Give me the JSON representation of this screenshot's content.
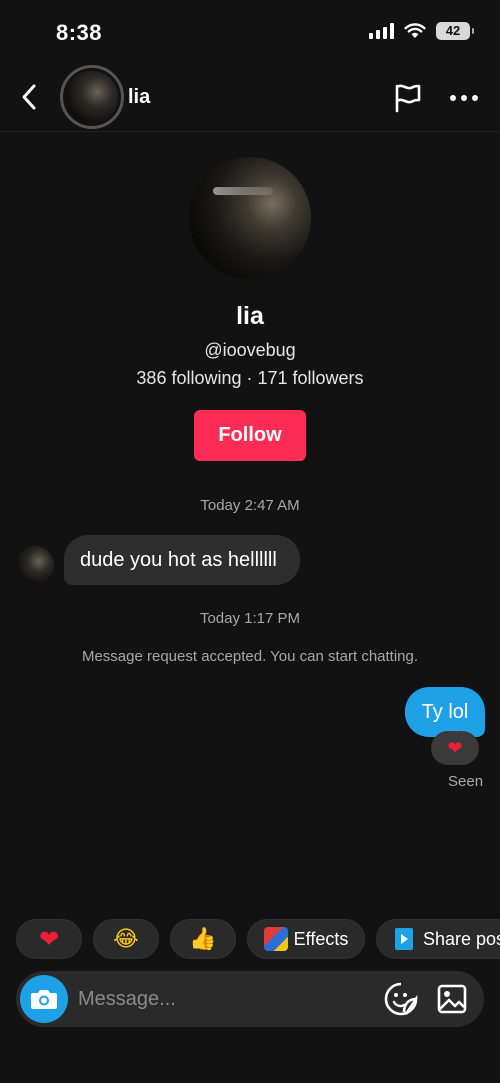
{
  "status_bar": {
    "time": "8:38",
    "battery": "42"
  },
  "header": {
    "name": "lia"
  },
  "profile": {
    "name": "lia",
    "handle": "@ioovebug",
    "stats": "386 following · 171 followers",
    "follow_label": "Follow"
  },
  "conversation": {
    "timestamp_1": "Today 2:47 AM",
    "incoming_message": "dude you hot as hellllll",
    "timestamp_2": "Today 1:17 PM",
    "system_message": "Message request accepted. You can start chatting.",
    "outgoing_message": "Ty lol",
    "reaction": "❤",
    "seen_label": "Seen"
  },
  "quick_replies": [
    {
      "icon": "heart-emoji",
      "glyph": "❤"
    },
    {
      "icon": "laughing-emoji",
      "glyph": "😂"
    },
    {
      "icon": "thumbs-up-emoji",
      "glyph": "👍"
    },
    {
      "icon": "effects-icon",
      "label": "Effects"
    },
    {
      "icon": "share-post-icon",
      "label": "Share post"
    }
  ],
  "composer": {
    "placeholder": "Message..."
  },
  "colors": {
    "accent_follow": "#fe2c55",
    "outgoing_bubble": "#1ea1e6",
    "background": "#121212"
  }
}
